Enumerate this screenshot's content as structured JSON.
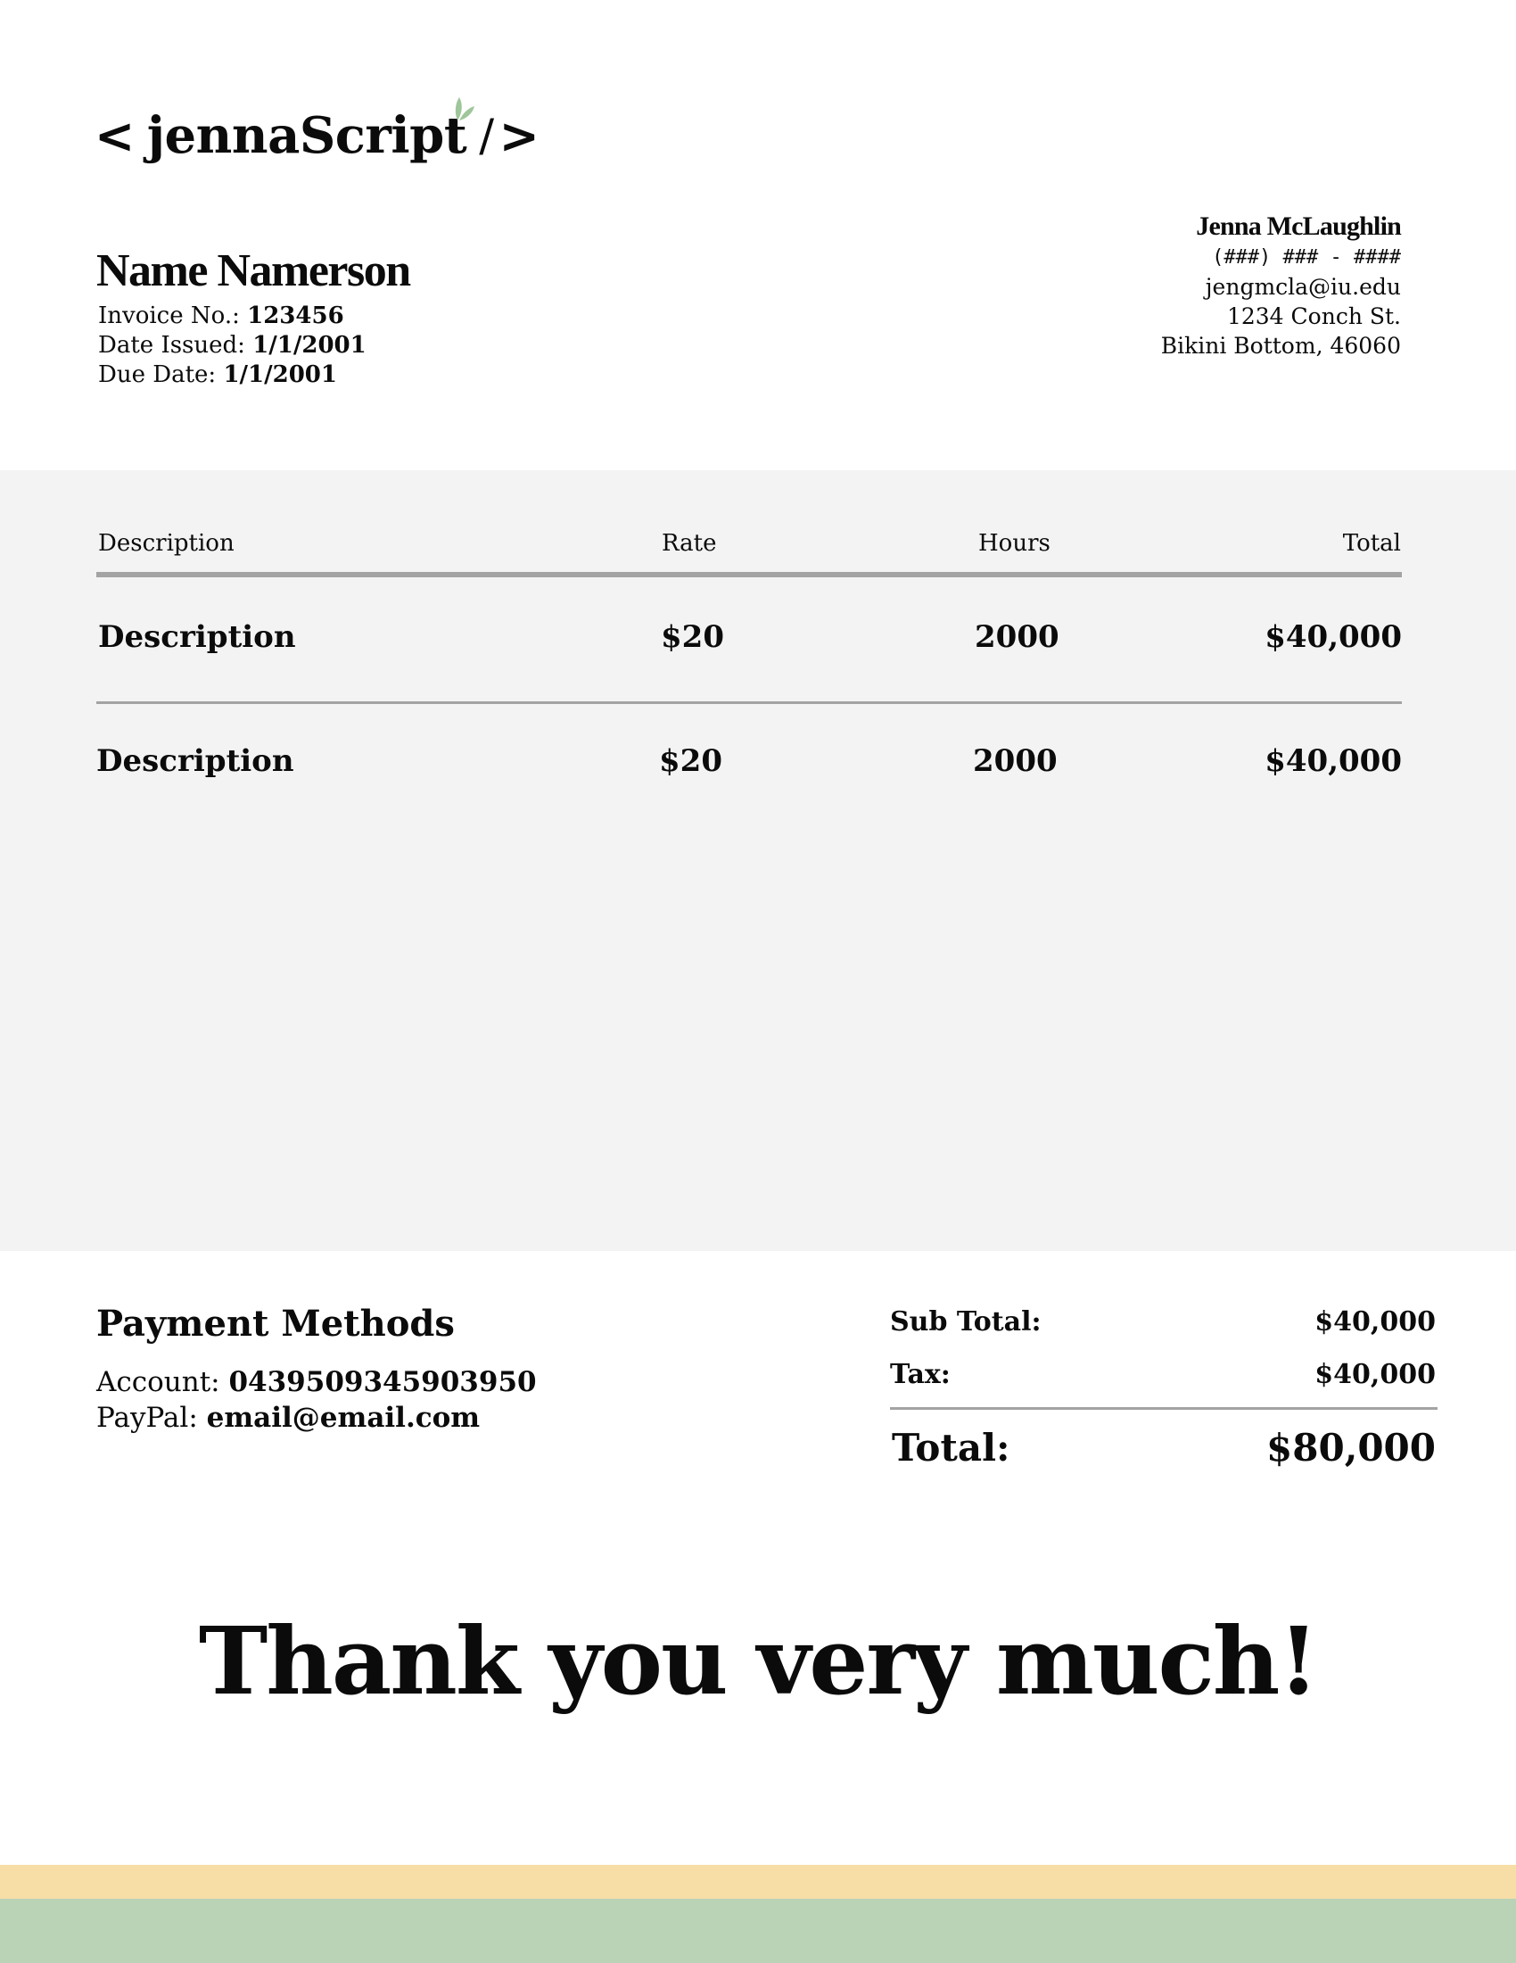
{
  "logo": {
    "open": "<",
    "word": "jennaScript",
    "slash": "/",
    "close": ">",
    "leaf_color": "#9fc69a"
  },
  "client": {
    "name": "Name Namerson",
    "invoice_label": "Invoice No.: ",
    "invoice_no": "123456",
    "issued_label": "Date Issued: ",
    "issued": "1/1/2001",
    "due_label": "Due Date: ",
    "due": "1/1/2001"
  },
  "sender": {
    "name": "Jenna McLaughlin",
    "phone": "(###) ### - ####",
    "email": "jengmcla@iu.edu",
    "address1": "1234 Conch St.",
    "address2": "Bikini Bottom, 46060"
  },
  "table": {
    "headers": [
      "Description",
      "Rate",
      "Hours",
      "Total"
    ],
    "rows": [
      [
        "Description",
        "$20",
        "2000",
        "$40,000"
      ],
      [
        "Description",
        "$20",
        "2000",
        "$40,000"
      ]
    ]
  },
  "payment": {
    "title": "Payment Methods",
    "account_label": "Account: ",
    "account": "0439509345903950",
    "paypal_label": "PayPal: ",
    "paypal": "email@email.com"
  },
  "totals": {
    "subtotal_label": "Sub Total:",
    "subtotal": "$40,000",
    "tax_label": "Tax:",
    "tax": "$40,000",
    "total_label": "Total:",
    "total": "$80,000"
  },
  "thanks": "Thank you very much!",
  "colors": {
    "band": "#f3f3f3",
    "rule": "#a3a3a3",
    "stripe_yellow": "#f7dea7",
    "stripe_green": "#bad2b5"
  }
}
